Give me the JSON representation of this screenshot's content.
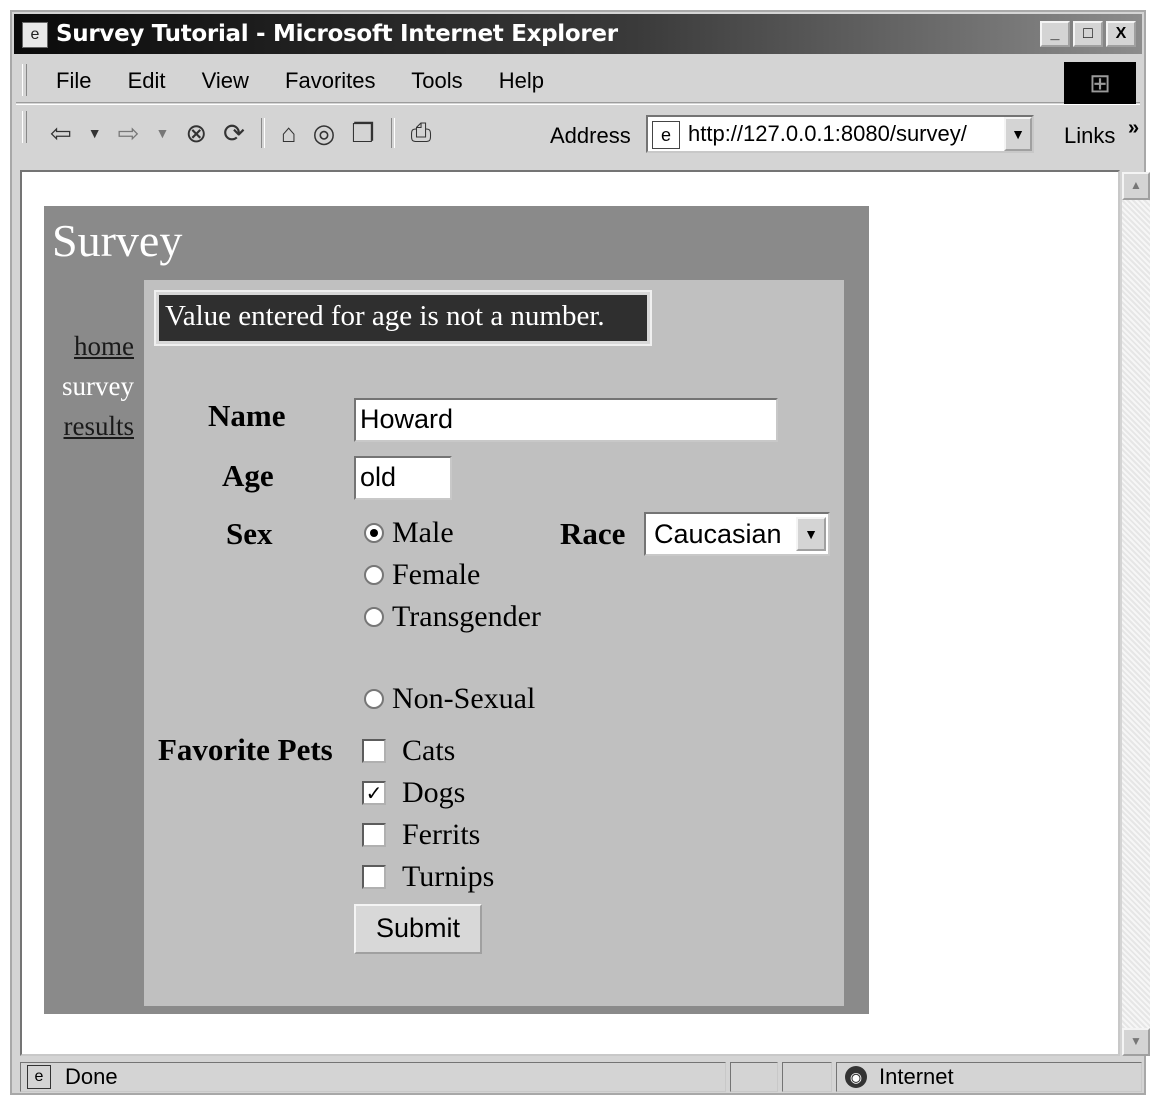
{
  "window": {
    "title": "Survey Tutorial - Microsoft Internet Explorer",
    "minimize": "_",
    "maximize": "□",
    "close": "X"
  },
  "menu": [
    "File",
    "Edit",
    "View",
    "Favorites",
    "Tools",
    "Help"
  ],
  "toolbar": {
    "icons": [
      "back-icon",
      "dropdown-icon",
      "forward-icon",
      "stop-icon",
      "refresh-icon",
      "home-icon",
      "search-icon",
      "favorites-icon",
      "history-icon",
      "print-icon"
    ],
    "address_label": "Address",
    "url": "http://127.0.0.1:8080/survey/",
    "links_label": "Links"
  },
  "page": {
    "title": "Survey",
    "nav": {
      "home": "home",
      "survey": "survey",
      "results": "results"
    },
    "error": "Value entered for age is not a number.",
    "name_label": "Name",
    "name_value": "Howard",
    "age_label": "Age",
    "age_value": "old",
    "sex_label": "Sex",
    "sex_options": [
      "Male",
      "Female",
      "Transgender",
      "Non-Sexual"
    ],
    "sex_selected": "Male",
    "race_label": "Race",
    "race_value": "Caucasian",
    "pets_label": "Favorite Pets",
    "pets": [
      {
        "label": "Cats",
        "checked": false
      },
      {
        "label": "Dogs",
        "checked": true
      },
      {
        "label": "Ferrits",
        "checked": false
      },
      {
        "label": "Turnips",
        "checked": false
      }
    ],
    "submit": "Submit"
  },
  "status": {
    "text": "Done",
    "zone": "Internet"
  },
  "colors": {
    "page_bg": "#8a8a8a",
    "content_bg": "#c0c0c0",
    "error_bg": "#2f2f2f"
  }
}
